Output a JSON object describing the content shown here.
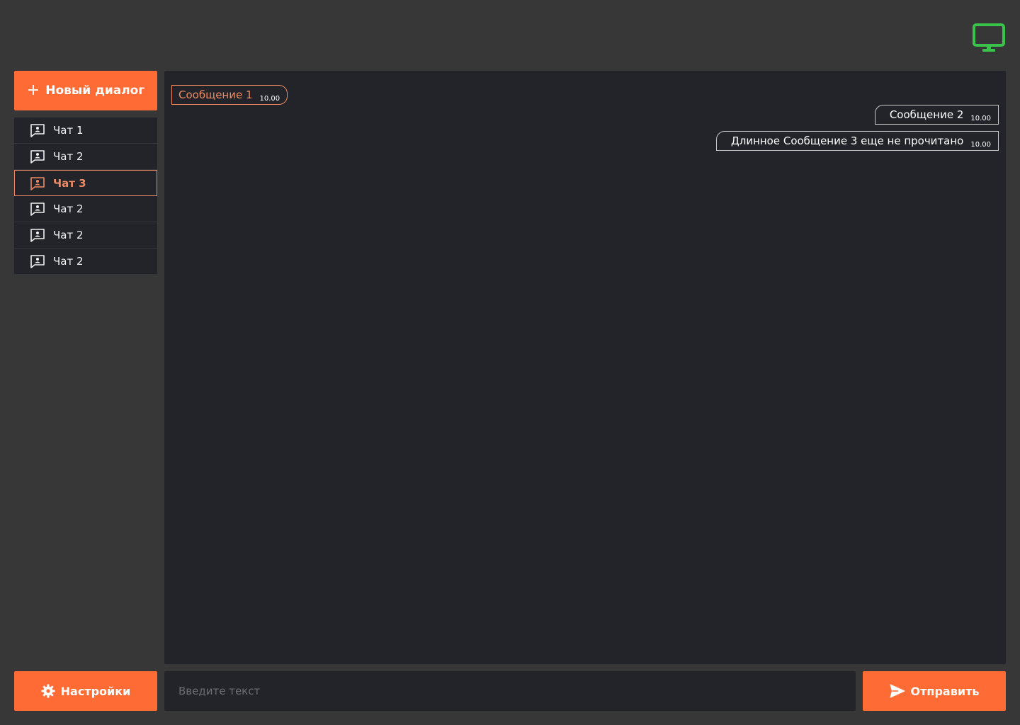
{
  "header": {
    "status_icon": "monitor-icon",
    "status_color": "#39c34a"
  },
  "sidebar": {
    "new_dialog_label": "Новый диалог",
    "new_dialog_icon": "plus-icon",
    "accent_color": "#ff6b35",
    "chats": [
      {
        "label": "Чат 1",
        "icon": "chat-icon",
        "active": false
      },
      {
        "label": "Чат 2",
        "icon": "chat-icon",
        "active": false
      },
      {
        "label": "Чат 3",
        "icon": "chat-icon",
        "active": true
      },
      {
        "label": "Чат 2",
        "icon": "chat-icon",
        "active": false
      },
      {
        "label": "Чат 2",
        "icon": "chat-icon",
        "active": false
      },
      {
        "label": "Чат 2",
        "icon": "chat-icon",
        "active": false
      }
    ],
    "settings_label": "Настройки",
    "settings_icon": "gear-icon"
  },
  "messages": [
    {
      "text": "Сообщение 1",
      "time": "10.00",
      "direction": "incoming"
    },
    {
      "text": "Сообщение 2",
      "time": "10.00",
      "direction": "outgoing"
    },
    {
      "text": "Длинное Сообщение 3 еще не прочитано",
      "time": "10.00",
      "direction": "outgoing"
    }
  ],
  "composer": {
    "placeholder": "Введите текст",
    "value": "",
    "send_label": "Отправить",
    "send_icon": "send-icon"
  }
}
